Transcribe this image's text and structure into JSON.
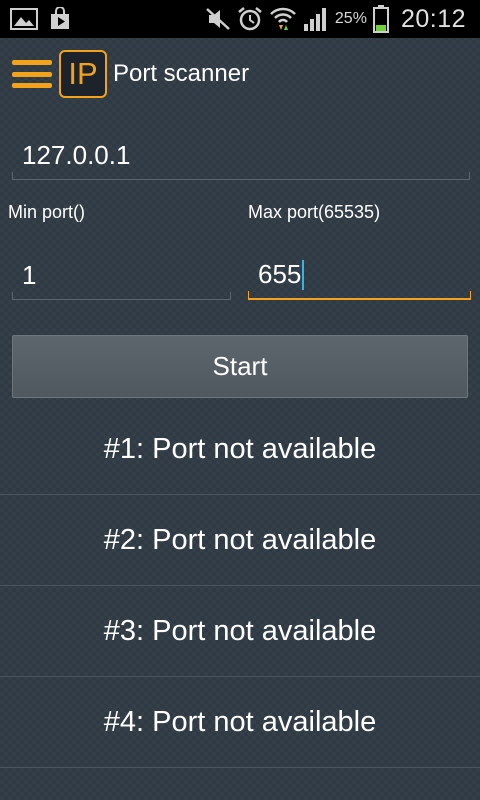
{
  "status_bar": {
    "battery_percent": "25%",
    "time": "20:12",
    "icons": [
      "gallery-icon",
      "play-store-icon",
      "mute-icon",
      "alarm-icon",
      "wifi-icon",
      "signal-icon",
      "battery-icon"
    ]
  },
  "action_bar": {
    "logo_text": "IP",
    "title": "Port scanner"
  },
  "form": {
    "host_value": "127.0.0.1",
    "min_port_label": "Min port()",
    "min_port_value": "1",
    "max_port_label": "Max port(65535)",
    "max_port_value": "655",
    "start_label": "Start"
  },
  "results": [
    {
      "text": "#1: Port not available"
    },
    {
      "text": "#2: Port not available"
    },
    {
      "text": "#3: Port not available"
    },
    {
      "text": "#4: Port not available"
    }
  ],
  "colors": {
    "accent": "#f2a21b",
    "background": "#2f3a44",
    "cursor": "#33b5e5"
  }
}
